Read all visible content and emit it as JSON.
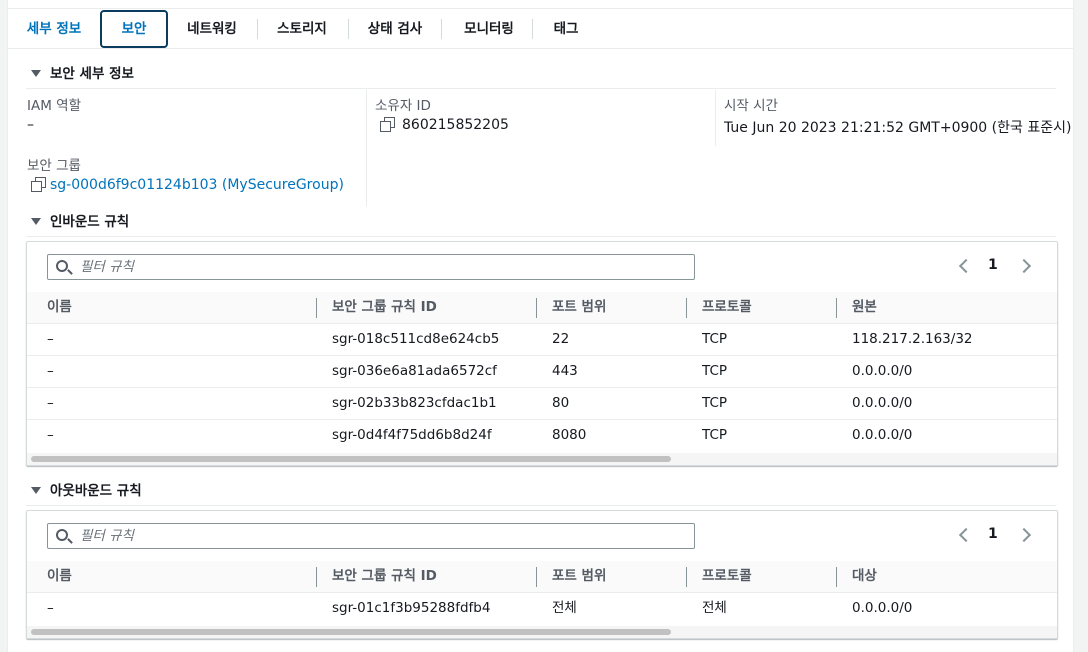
{
  "tabs": [
    {
      "label": "세부 정보"
    },
    {
      "label": "보안"
    },
    {
      "label": "네트워킹"
    },
    {
      "label": "스토리지"
    },
    {
      "label": "상태 검사"
    },
    {
      "label": "모니터링"
    },
    {
      "label": "태그"
    }
  ],
  "security_details": {
    "title": "보안 세부 정보",
    "iam_role_label": "IAM 역할",
    "iam_role_value": "–",
    "owner_id_label": "소유자 ID",
    "owner_id_value": "860215852205",
    "launch_time_label": "시작 시간",
    "launch_time_value": "Tue Jun 20 2023 21:21:52 GMT+0900 (한국 표준시)",
    "security_groups_label": "보안 그룹",
    "security_group_link": "sg-000d6f9c01124b103 (MySecureGroup)"
  },
  "inbound": {
    "title": "인바운드 규칙",
    "filter_placeholder": "필터 규칙",
    "page": "1",
    "columns": [
      "이름",
      "보안 그룹 규칙 ID",
      "포트 범위",
      "프로토콜",
      "원본"
    ],
    "rows": [
      [
        "–",
        "sgr-018c511cd8e624cb5",
        "22",
        "TCP",
        "118.217.2.163/32"
      ],
      [
        "–",
        "sgr-036e6a81ada6572cf",
        "443",
        "TCP",
        "0.0.0.0/0"
      ],
      [
        "–",
        "sgr-02b33b823cfdac1b1",
        "80",
        "TCP",
        "0.0.0.0/0"
      ],
      [
        "–",
        "sgr-0d4f4f75dd6b8d24f",
        "8080",
        "TCP",
        "0.0.0.0/0"
      ]
    ]
  },
  "outbound": {
    "title": "아웃바운드 규칙",
    "filter_placeholder": "필터 규칙",
    "page": "1",
    "columns": [
      "이름",
      "보안 그룹 규칙 ID",
      "포트 범위",
      "프로토콜",
      "대상"
    ],
    "rows": [
      [
        "–",
        "sgr-01c1f3b95288fdfb4",
        "전체",
        "전체",
        "0.0.0.0/0"
      ]
    ]
  },
  "colors": {
    "link": "#0073bb",
    "active_tab_border": "#0b3c5d"
  }
}
